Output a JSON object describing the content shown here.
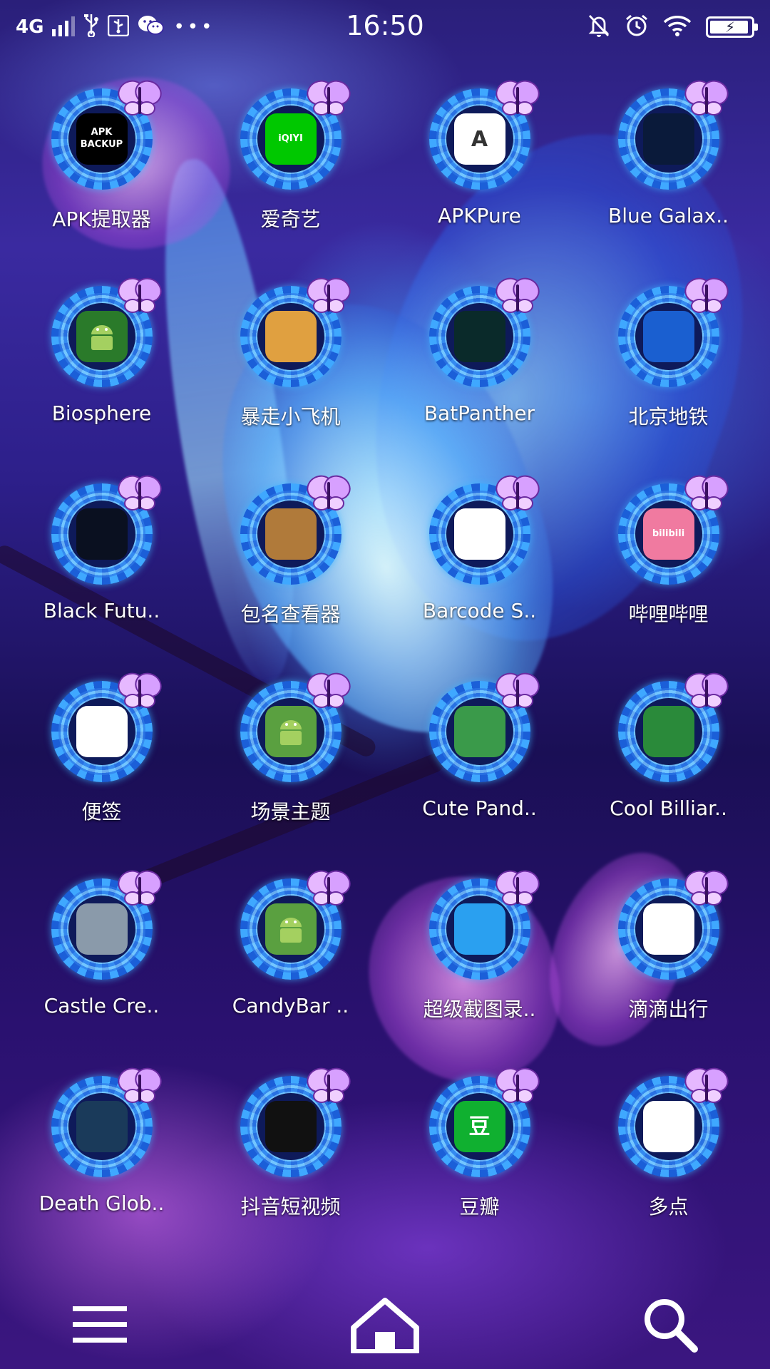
{
  "status_bar": {
    "network": "4G",
    "time": "16:50",
    "battery_level": 0.95,
    "icons": [
      "signal-icon",
      "usb-icon",
      "usb-debug-icon",
      "wechat-icon",
      "more-notifications-icon",
      "mute-icon",
      "alarm-icon",
      "wifi-icon",
      "battery-charging-icon"
    ]
  },
  "apps": [
    {
      "label": "APK提取器",
      "icon": "apk-backup-icon",
      "color": "#000000",
      "glyph": "APK\nBACKUP"
    },
    {
      "label": "爱奇艺",
      "icon": "iqiyi-icon",
      "color": "#00c800",
      "glyph": "iQIYI"
    },
    {
      "label": "APKPure",
      "icon": "apkpure-icon",
      "color": "#ffffff",
      "glyph": "A"
    },
    {
      "label": "Blue Galax..",
      "icon": "blue-galaxy-icon",
      "color": "#0a1a3a",
      "glyph": ""
    },
    {
      "label": "Biosphere",
      "icon": "android-robot-icon",
      "color": "#2a7a2a",
      "glyph": ""
    },
    {
      "label": "暴走小飞机",
      "icon": "plane-game-icon",
      "color": "#e0a040",
      "glyph": ""
    },
    {
      "label": "BatPanther",
      "icon": "batpanther-icon",
      "color": "#0a2a2a",
      "glyph": ""
    },
    {
      "label": "北京地铁",
      "icon": "beijing-subway-icon",
      "color": "#1a5fd0",
      "glyph": ""
    },
    {
      "label": "Black Futu..",
      "icon": "black-future-icon",
      "color": "#0a1020",
      "glyph": ""
    },
    {
      "label": "包名查看器",
      "icon": "package-viewer-icon",
      "color": "#b07a3a",
      "glyph": ""
    },
    {
      "label": "Barcode S..",
      "icon": "barcode-scanner-icon",
      "color": "#ffffff",
      "glyph": ""
    },
    {
      "label": "哔哩哔哩",
      "icon": "bilibili-icon",
      "color": "#f07aa0",
      "glyph": "bilibili"
    },
    {
      "label": "便签",
      "icon": "notes-icon",
      "color": "#ffffff",
      "glyph": ""
    },
    {
      "label": "场景主题",
      "icon": "android-robot-icon",
      "color": "#5aa040",
      "glyph": ""
    },
    {
      "label": "Cute Pand..",
      "icon": "panda-icon",
      "color": "#3a9a4a",
      "glyph": ""
    },
    {
      "label": "Cool Billiar..",
      "icon": "billiards-icon",
      "color": "#2a8a3a",
      "glyph": ""
    },
    {
      "label": "Castle Cre..",
      "icon": "castle-icon",
      "color": "#8a9aaa",
      "glyph": ""
    },
    {
      "label": "CandyBar ..",
      "icon": "android-robot-icon",
      "color": "#5aa040",
      "glyph": ""
    },
    {
      "label": "超级截图录..",
      "icon": "screen-recorder-icon",
      "color": "#2aa0f0",
      "glyph": ""
    },
    {
      "label": "滴滴出行",
      "icon": "didi-icon",
      "color": "#ffffff",
      "glyph": ""
    },
    {
      "label": "Death Glob..",
      "icon": "death-globe-icon",
      "color": "#1a3a5a",
      "glyph": ""
    },
    {
      "label": "抖音短视频",
      "icon": "douyin-icon",
      "color": "#111111",
      "glyph": ""
    },
    {
      "label": "豆瓣",
      "icon": "douban-icon",
      "color": "#10b030",
      "glyph": "豆"
    },
    {
      "label": "多点",
      "icon": "dmall-icon",
      "color": "#ffffff",
      "glyph": ""
    }
  ],
  "dock": {
    "items": [
      "menu-icon",
      "home-icon",
      "search-icon"
    ]
  }
}
